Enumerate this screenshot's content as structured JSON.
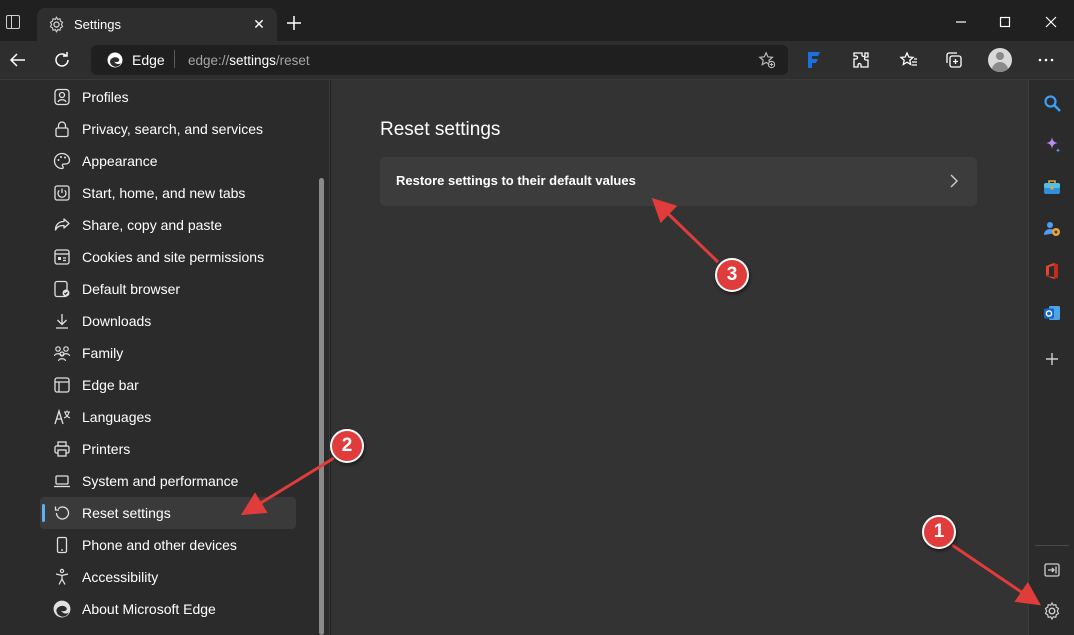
{
  "tab": {
    "title": "Settings",
    "close": "✕"
  },
  "address_bar": {
    "site_label": "Edge",
    "url_prefix": "edge://",
    "url_host": "settings",
    "url_path": "/reset"
  },
  "sidebar": {
    "items": [
      {
        "label": "Profiles",
        "icon": "profile-icon"
      },
      {
        "label": "Privacy, search, and services",
        "icon": "lock-icon"
      },
      {
        "label": "Appearance",
        "icon": "palette-icon"
      },
      {
        "label": "Start, home, and new tabs",
        "icon": "power-icon"
      },
      {
        "label": "Share, copy and paste",
        "icon": "share-icon"
      },
      {
        "label": "Cookies and site permissions",
        "icon": "cookies-icon"
      },
      {
        "label": "Default browser",
        "icon": "browser-icon"
      },
      {
        "label": "Downloads",
        "icon": "download-icon"
      },
      {
        "label": "Family",
        "icon": "family-icon"
      },
      {
        "label": "Edge bar",
        "icon": "edge-bar-icon"
      },
      {
        "label": "Languages",
        "icon": "languages-icon"
      },
      {
        "label": "Printers",
        "icon": "printer-icon"
      },
      {
        "label": "System and performance",
        "icon": "laptop-icon"
      },
      {
        "label": "Reset settings",
        "icon": "reset-icon",
        "active": true
      },
      {
        "label": "Phone and other devices",
        "icon": "phone-icon"
      },
      {
        "label": "Accessibility",
        "icon": "accessibility-icon"
      },
      {
        "label": "About Microsoft Edge",
        "icon": "edge-logo-icon"
      }
    ]
  },
  "main": {
    "title": "Reset settings",
    "restore_label": "Restore settings to their default values"
  },
  "annotations": {
    "one": "1",
    "two": "2",
    "three": "3"
  },
  "colors": {
    "accent": "#60b0f4",
    "annotation": "#e03c3c",
    "background": "#333333"
  }
}
